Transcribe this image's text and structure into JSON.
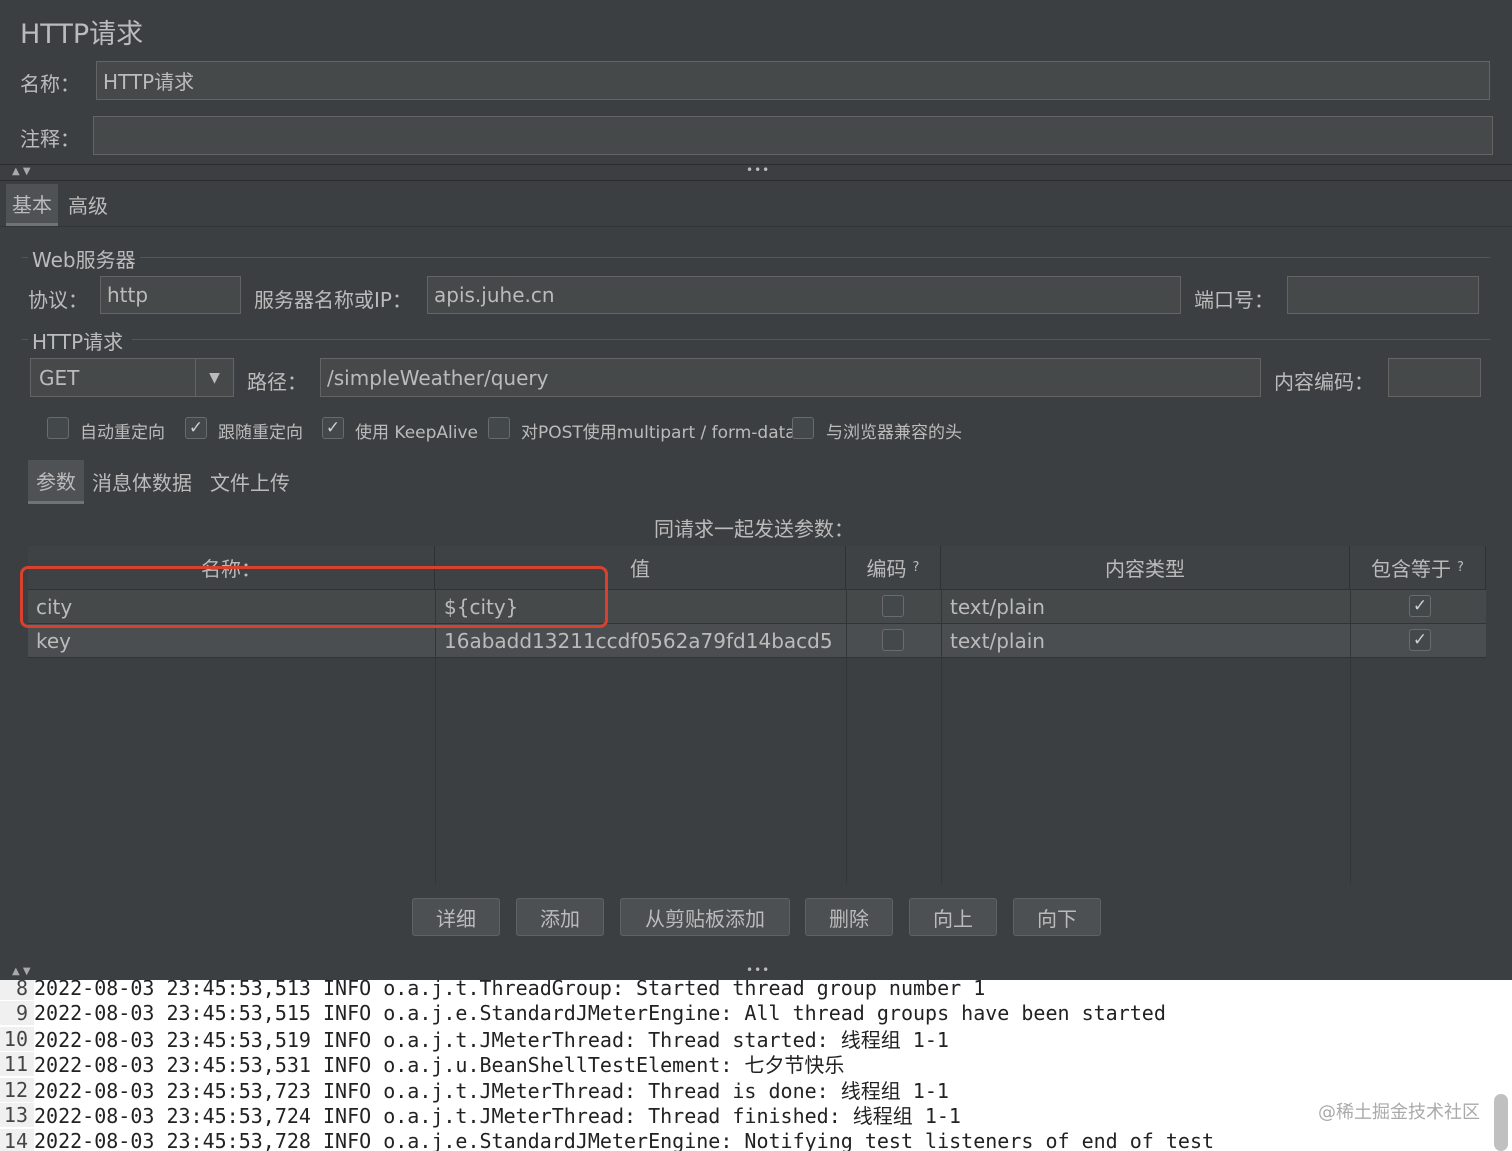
{
  "panel": {
    "title": "HTTP请求",
    "name_label": "名称：",
    "name_value": "HTTP请求",
    "comment_label": "注释：",
    "comment_value": ""
  },
  "tabs": {
    "basic": "基本",
    "advanced": "高级"
  },
  "web_server": {
    "group_label": "Web服务器",
    "protocol_label": "协议：",
    "protocol_value": "http",
    "server_label": "服务器名称或IP：",
    "server_value": "apis.juhe.cn",
    "port_label": "端口号：",
    "port_value": ""
  },
  "http_request": {
    "group_label": "HTTP请求",
    "method": "GET",
    "path_label": "路径：",
    "path_value": "/simpleWeather/query",
    "encoding_label": "内容编码：",
    "encoding_value": ""
  },
  "options": [
    {
      "label": "自动重定向",
      "checked": false
    },
    {
      "label": "跟随重定向",
      "checked": true
    },
    {
      "label": "使用 KeepAlive",
      "checked": true
    },
    {
      "label": "对POST使用multipart / form-data",
      "checked": false
    },
    {
      "label": "与浏览器兼容的头",
      "checked": false
    }
  ],
  "subtabs": {
    "params": "参数",
    "body": "消息体数据",
    "files": "文件上传"
  },
  "params_table": {
    "caption": "同请求一起发送参数：",
    "headers": {
      "name": "名称：",
      "value": "值",
      "encode": "编码",
      "content_type": "内容类型",
      "include_equals": "包含等于"
    },
    "help_mark": "?",
    "rows": [
      {
        "name": "city",
        "value": "${city}",
        "encode": false,
        "content_type": "text/plain",
        "include_equals": true
      },
      {
        "name": "key",
        "value": "16abadd13211ccdf0562a79fd14bacd5",
        "encode": false,
        "content_type": "text/plain",
        "include_equals": true
      }
    ]
  },
  "buttons": {
    "detail": "详细",
    "add": "添加",
    "add_clipboard": "从剪贴板添加",
    "delete": "删除",
    "up": "向上",
    "down": "向下"
  },
  "log": [
    {
      "n": "8",
      "text": "2022-08-03 23:45:53,513 INFO o.a.j.t.ThreadGroup: Started thread group number 1"
    },
    {
      "n": "9",
      "text": "2022-08-03 23:45:53,515 INFO o.a.j.e.StandardJMeterEngine: All thread groups have been started"
    },
    {
      "n": "10",
      "text": "2022-08-03 23:45:53,519 INFO o.a.j.t.JMeterThread: Thread started: 线程组 1-1"
    },
    {
      "n": "11",
      "text": "2022-08-03 23:45:53,531 INFO o.a.j.u.BeanShellTestElement: 七夕节快乐"
    },
    {
      "n": "12",
      "text": "2022-08-03 23:45:53,723 INFO o.a.j.t.JMeterThread: Thread is done: 线程组 1-1"
    },
    {
      "n": "13",
      "text": "2022-08-03 23:45:53,724 INFO o.a.j.t.JMeterThread: Thread finished: 线程组 1-1"
    },
    {
      "n": "14",
      "text": "2022-08-03 23:45:53,728 INFO o.a.j.e.StandardJMeterEngine: Notifying test listeners of end of test"
    }
  ],
  "watermark": "@稀土掘金技术社区",
  "icons": {
    "dropdown": "chevron-down-icon",
    "check": "checkmark-icon",
    "grip": "drag-grip-icon"
  },
  "colors": {
    "background": "#3c3f41",
    "field": "#45494a",
    "highlight": "#d9412e",
    "log_bg": "#ffffff"
  }
}
